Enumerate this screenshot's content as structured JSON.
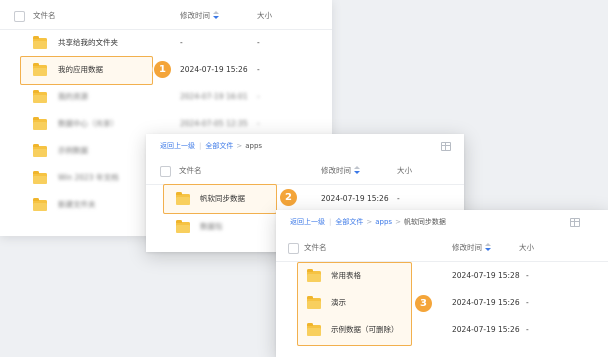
{
  "panel1": {
    "header": {
      "name": "文件名",
      "modified": "修改时间",
      "size": "大小"
    },
    "rows": [
      {
        "name": "共享给我的文件夹",
        "modified": "-",
        "size": "-"
      },
      {
        "name": "我的应用数据",
        "modified": "2024-07-19 15:26",
        "size": "-"
      },
      {
        "name": "我的资源",
        "modified": "2024-07-19 16:01",
        "size": "-"
      },
      {
        "name": "数据中心（共享）",
        "modified": "2024-07-05 12:35",
        "size": "-"
      },
      {
        "name": "示例数据",
        "modified": "",
        "size": ""
      },
      {
        "name": "Win 2023 年文档",
        "modified": "",
        "size": ""
      },
      {
        "name": "新建文件夹",
        "modified": "",
        "size": ""
      }
    ],
    "marker": "1"
  },
  "panel2": {
    "breadcrumb": {
      "back": "返回上一级",
      "all": "全部文件",
      "sep": ">",
      "current": "apps"
    },
    "header": {
      "name": "文件名",
      "modified": "修改时间",
      "size": "大小"
    },
    "rows": [
      {
        "name": "帆软同步数据",
        "modified": "2024-07-19 15:26",
        "size": "-"
      },
      {
        "name": "数据包",
        "modified": "",
        "size": ""
      }
    ],
    "marker": "2"
  },
  "panel3": {
    "breadcrumb": {
      "back": "返回上一级",
      "all": "全部文件",
      "sep": ">",
      "mid": "apps",
      "current": "帆软同步数据"
    },
    "header": {
      "name": "文件名",
      "modified": "修改时间",
      "size": "大小"
    },
    "rows": [
      {
        "name": "常用表格",
        "modified": "2024-07-19 15:28",
        "size": "-"
      },
      {
        "name": "演示",
        "modified": "2024-07-19 15:26",
        "size": "-"
      },
      {
        "name": "示例数据（可删除）",
        "modified": "2024-07-19 15:26",
        "size": "-"
      }
    ],
    "marker": "3"
  },
  "colors": {
    "accent": "#3b78e7",
    "highlight": "#f2b04e",
    "marker": "#f4a53a",
    "folder": "#f6c343"
  },
  "icons": [
    "folder-icon",
    "sort-icon",
    "grid-view-icon",
    "checkbox"
  ]
}
